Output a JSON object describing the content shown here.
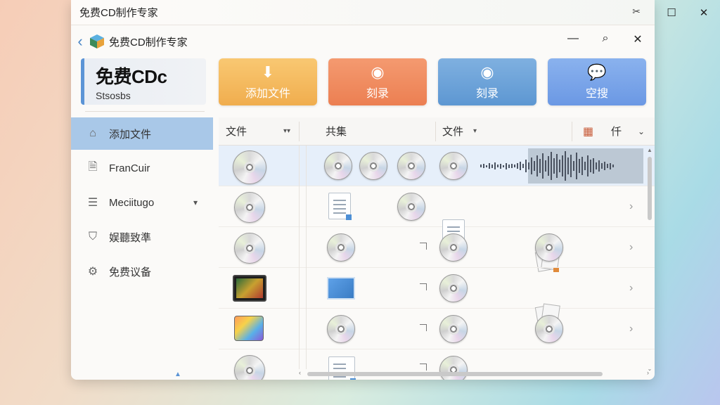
{
  "outer_window": {
    "title": "免费CD制作专家",
    "right_icon": "✂"
  },
  "inner_title": {
    "title": "免费CD制作专家"
  },
  "brand": {
    "big": "免费CDc",
    "small": "Stsosbs"
  },
  "toolbar": [
    {
      "label": "添加文件",
      "icon": "download-icon",
      "color": "#f0ad4e"
    },
    {
      "label": "刻录",
      "icon": "disc-icon",
      "color": "#ec7f52"
    },
    {
      "label": "刻录",
      "icon": "disc-icon",
      "color": "#5d97d2"
    },
    {
      "label": "空搜",
      "icon": "chat-icon",
      "color": "#6b98e4"
    }
  ],
  "sidebar": [
    {
      "label": "添加文件",
      "icon": "home-icon",
      "active": true
    },
    {
      "label": "FranCuir",
      "icon": "document-icon"
    },
    {
      "label": "Meciitugo",
      "icon": "list-icon",
      "has_chevron": true
    },
    {
      "label": "娱聽致準",
      "icon": "shield-icon"
    },
    {
      "label": "免费议备",
      "icon": "gear-icon"
    }
  ],
  "table": {
    "headers": [
      "文件",
      "共集",
      "文件",
      "仟"
    ]
  }
}
